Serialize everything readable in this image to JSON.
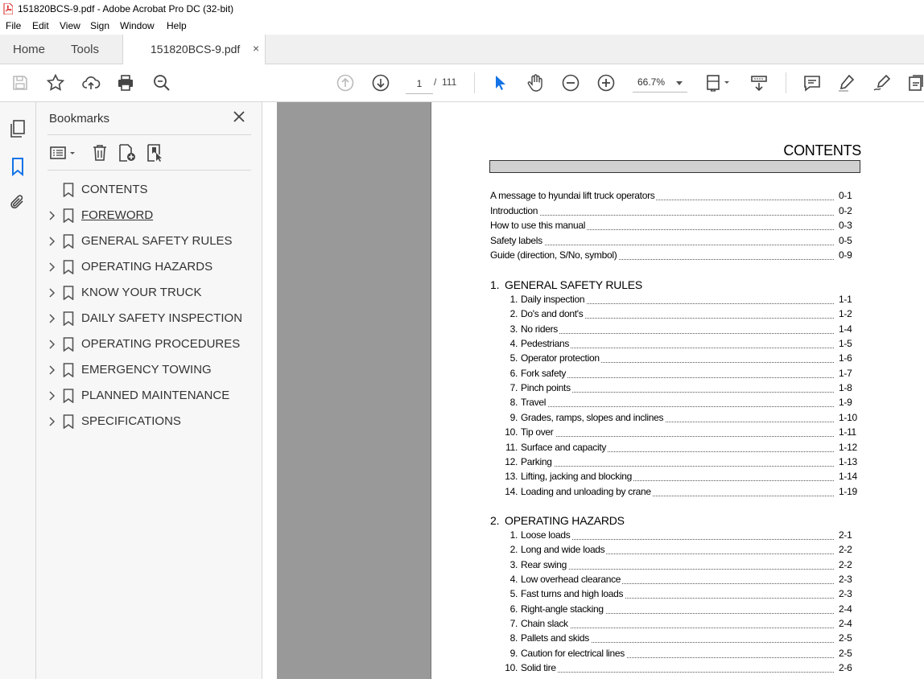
{
  "window": {
    "title": "151820BCS-9.pdf - Adobe Acrobat Pro DC (32-bit)"
  },
  "menu": [
    "File",
    "Edit",
    "View",
    "Sign",
    "Window",
    "Help"
  ],
  "tabs": {
    "home": "Home",
    "tools": "Tools",
    "document": "151820BCS-9.pdf",
    "close_glyph": "×"
  },
  "toolbar": {
    "page_current": "1",
    "page_separator": "/",
    "page_total": "111",
    "zoom": "66.7%"
  },
  "bookmarks": {
    "header": "Bookmarks",
    "items": [
      {
        "label": "CONTENTS",
        "expandable": false,
        "underlined": false
      },
      {
        "label": "FOREWORD",
        "expandable": true,
        "underlined": true
      },
      {
        "label": "GENERAL SAFETY RULES",
        "expandable": true,
        "underlined": false
      },
      {
        "label": "OPERATING HAZARDS",
        "expandable": true,
        "underlined": false
      },
      {
        "label": "KNOW YOUR TRUCK",
        "expandable": true,
        "underlined": false
      },
      {
        "label": "DAILY SAFETY INSPECTION",
        "expandable": true,
        "underlined": false
      },
      {
        "label": "OPERATING PROCEDURES",
        "expandable": true,
        "underlined": false
      },
      {
        "label": "EMERGENCY TOWING",
        "expandable": true,
        "underlined": false
      },
      {
        "label": "PLANNED MAINTENANCE",
        "expandable": true,
        "underlined": false
      },
      {
        "label": "SPECIFICATIONS",
        "expandable": true,
        "underlined": false
      }
    ]
  },
  "document": {
    "title": "CONTENTS",
    "intro_entries": [
      {
        "text": "A message to hyundai lift truck operators",
        "page": "0-1"
      },
      {
        "text": "Introduction",
        "page": "0-2"
      },
      {
        "text": "How to use this manual",
        "page": "0-3"
      },
      {
        "text": "Safety labels",
        "page": "0-5"
      },
      {
        "text": "Guide (direction, S/No, symbol)",
        "page": "0-9"
      }
    ],
    "sections": [
      {
        "number": "1.",
        "title": "GENERAL SAFETY RULES",
        "entries": [
          {
            "n": "1.",
            "text": "Daily inspection",
            "page": "1-1"
          },
          {
            "n": "2.",
            "text": "Do's and dont's",
            "page": "1-2"
          },
          {
            "n": "3.",
            "text": "No riders",
            "page": "1-4"
          },
          {
            "n": "4.",
            "text": "Pedestrians",
            "page": "1-5"
          },
          {
            "n": "5.",
            "text": "Operator protection",
            "page": "1-6"
          },
          {
            "n": "6.",
            "text": "Fork safety",
            "page": "1-7"
          },
          {
            "n": "7.",
            "text": "Pinch points",
            "page": "1-8"
          },
          {
            "n": "8.",
            "text": "Travel",
            "page": "1-9"
          },
          {
            "n": "9.",
            "text": "Grades, ramps, slopes and inclines",
            "page": "1-10"
          },
          {
            "n": "10.",
            "text": "Tip over",
            "page": "1-11"
          },
          {
            "n": "11.",
            "text": "Surface and capacity",
            "page": "1-12"
          },
          {
            "n": "12.",
            "text": "Parking",
            "page": "1-13"
          },
          {
            "n": "13.",
            "text": "Lifting, jacking and blocking",
            "page": "1-14"
          },
          {
            "n": "14.",
            "text": "Loading and unloading by crane",
            "page": "1-19"
          }
        ]
      },
      {
        "number": "2.",
        "title": "OPERATING HAZARDS",
        "entries": [
          {
            "n": "1.",
            "text": "Loose loads",
            "page": "2-1"
          },
          {
            "n": "2.",
            "text": "Long and wide loads",
            "page": "2-2"
          },
          {
            "n": "3.",
            "text": "Rear swing",
            "page": "2-2"
          },
          {
            "n": "4.",
            "text": "Low overhead clearance",
            "page": "2-3"
          },
          {
            "n": "5.",
            "text": "Fast turns and high loads",
            "page": "2-3"
          },
          {
            "n": "6.",
            "text": "Right-angle stacking",
            "page": "2-4"
          },
          {
            "n": "7.",
            "text": "Chain slack",
            "page": "2-4"
          },
          {
            "n": "8.",
            "text": "Pallets and skids",
            "page": "2-5"
          },
          {
            "n": "9.",
            "text": "Caution for electrical lines",
            "page": "2-5"
          },
          {
            "n": "10.",
            "text": "Solid tire",
            "page": "2-6"
          }
        ]
      }
    ]
  },
  "colors": {
    "accent_blue": "#1473e6",
    "pdf_red": "#d4201f",
    "viewer_gray": "#999999"
  }
}
